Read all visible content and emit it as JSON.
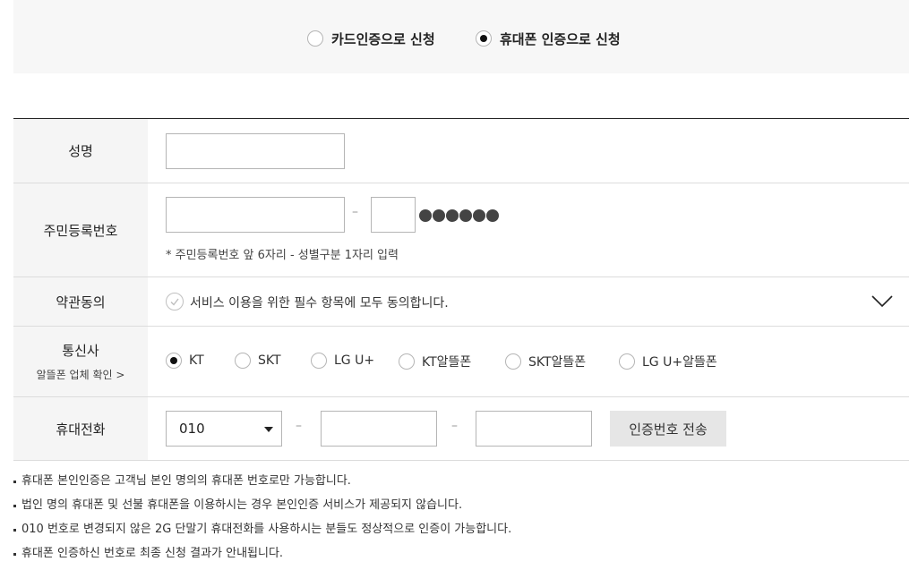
{
  "method": {
    "options": [
      {
        "label": "카드인증으로 신청",
        "selected": false
      },
      {
        "label": "휴대폰 인증으로 신청",
        "selected": true
      }
    ]
  },
  "form": {
    "name": {
      "label": "성명",
      "value": ""
    },
    "rrn": {
      "label": "주민등록번호",
      "front_value": "",
      "gender_value": "",
      "masked": "●●●●●●",
      "hint": "* 주민등록번호 앞 6자리 - 성별구분 1자리 입력"
    },
    "terms": {
      "label": "약관동의",
      "text": "서비스 이용을 위한 필수 항목에 모두 동의합니다.",
      "checked": false
    },
    "carrier": {
      "label": "통신사",
      "sublabel": "알뜰폰 업체 확인 >",
      "options": [
        {
          "label": "KT",
          "selected": true
        },
        {
          "label": "SKT",
          "selected": false
        },
        {
          "label": "LG U+",
          "selected": false
        },
        {
          "label": "KT알뜰폰",
          "selected": false
        },
        {
          "label": "SKT알뜰폰",
          "selected": false
        },
        {
          "label": "LG U+알뜰폰",
          "selected": false
        }
      ]
    },
    "phone": {
      "label": "휴대전화",
      "prefix": "010",
      "middle": "",
      "last": "",
      "dash": "–",
      "send_button": "인증번호 전송"
    }
  },
  "notes": [
    "휴대폰 본인인증은 고객님 본인 명의의 휴대폰 번호로만 가능합니다.",
    "법인 명의 휴대폰 및 선불 휴대폰을 이용하시는 경우 본인인증 서비스가 제공되지 않습니다.",
    "010 번호로 변경되지 않은 2G 단말기 휴대전화를 사용하시는 분들도 정상적으로 인증이 가능합니다.",
    "휴대폰 인증하신 번호로 최종 신청 결과가 안내됩니다."
  ],
  "icons": {
    "radio": "radio-icon",
    "check": "check-circle-icon",
    "expand": "chevron-down-icon",
    "dropdown": "caret-down-icon"
  }
}
